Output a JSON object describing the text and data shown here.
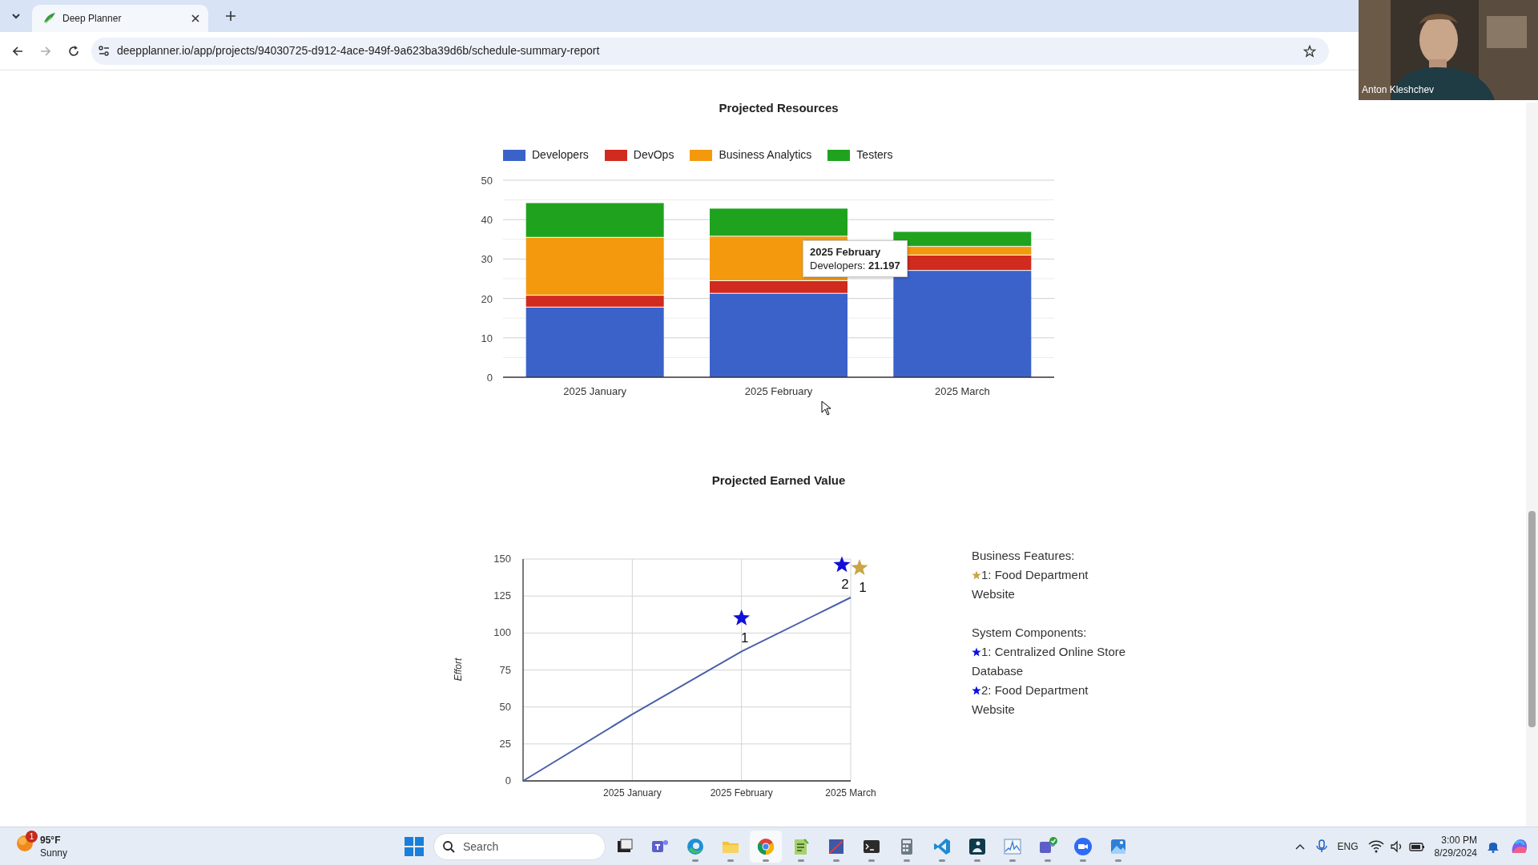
{
  "browser": {
    "tab_title": "Deep Planner",
    "url": "deepplanner.io/app/projects/94030725-d912-4ace-949f-9a623ba39d6b/schedule-summary-report",
    "forward_disabled": true
  },
  "resources_chart": {
    "chart_data": {
      "type": "bar",
      "title": "Projected Resources",
      "categories": [
        "2025 January",
        "2025 February",
        "2025 March"
      ],
      "stacked": true,
      "grid": true,
      "legend": true,
      "ylim": [
        0,
        50
      ],
      "yticks": [
        0,
        10,
        20,
        30,
        40,
        50
      ],
      "series": [
        {
          "name": "Developers",
          "color": "#3b62c9",
          "values": [
            17.7,
            21.197,
            27.0
          ]
        },
        {
          "name": "DevOps",
          "color": "#d02b1e",
          "values": [
            3.0,
            3.2,
            3.9
          ]
        },
        {
          "name": "Business Analytics",
          "color": "#f4990e",
          "values": [
            14.7,
            11.3,
            2.2
          ]
        },
        {
          "name": "Testers",
          "color": "#1fa31f",
          "values": [
            8.8,
            7.1,
            3.8
          ]
        }
      ]
    },
    "tooltip": {
      "title": "2025 February",
      "text": "Developers: **21.197**"
    }
  },
  "earned_value_chart": {
    "chart_data": {
      "type": "line",
      "title": "Projected Earned Value",
      "grid": true,
      "ylabel": "Effort",
      "categories": [
        null,
        "2025 January",
        "2025 February",
        "2025 March"
      ],
      "ylim": [
        0,
        150
      ],
      "yticks": [
        0,
        25,
        50,
        75,
        100,
        125,
        150
      ],
      "series": [
        {
          "color": "#4a5fa8",
          "values": [
            0,
            45,
            87.5,
            124
          ]
        },
        {
          "type": "scatter",
          "color": "#1010d8",
          "marker": "star",
          "values": [
            null,
            null,
            110,
            146
          ]
        },
        {
          "type": "scatter",
          "color": "#c9a546",
          "marker": "star",
          "values": [
            null,
            null,
            null,
            144
          ]
        }
      ],
      "annotations": [
        {
          "x": "2025 February",
          "y": 110,
          "text": "1"
        },
        {
          "x": "2025 March",
          "y": 146,
          "text": "2"
        },
        {
          "x": "2025 March",
          "y": 144,
          "text": "1"
        }
      ]
    }
  },
  "milestones": [
    {
      "heading": "Business Features:",
      "items": [
        {
          "color": "#c9a546",
          "text": "1: Food Department Website"
        }
      ]
    },
    {
      "heading": "System Components:",
      "items": [
        {
          "color": "#1010d8",
          "text": "1: Centralized Online Store Database"
        },
        {
          "color": "#1010d8",
          "text": "2: Food Department Website"
        }
      ]
    }
  ],
  "webcam": {
    "name": "Anton Kleshchev"
  },
  "taskbar": {
    "weather": {
      "badge": "1",
      "temperature": "95°F",
      "condition": "Sunny"
    },
    "search_placeholder": "Search",
    "apps": [
      {
        "kind": "window",
        "running": false,
        "selected": false
      },
      {
        "kind": "teams",
        "running": false,
        "selected": false
      },
      {
        "kind": "edge",
        "running": true,
        "selected": false
      },
      {
        "kind": "folder",
        "running": true,
        "selected": false
      },
      {
        "kind": "chrome",
        "running": true,
        "selected": true
      },
      {
        "kind": "notepad",
        "running": true,
        "selected": false
      },
      {
        "kind": "sketch",
        "running": true,
        "selected": false
      },
      {
        "kind": "terminal",
        "running": true,
        "selected": false
      },
      {
        "kind": "calculator",
        "running": true,
        "selected": false
      },
      {
        "kind": "vscode",
        "running": true,
        "selected": false
      },
      {
        "kind": "reader",
        "running": true,
        "selected": false
      },
      {
        "kind": "monitor",
        "running": true,
        "selected": false
      },
      {
        "kind": "teams-check",
        "running": true,
        "selected": false
      },
      {
        "kind": "zoom",
        "running": true,
        "selected": false
      },
      {
        "kind": "photos",
        "running": true,
        "selected": false
      }
    ],
    "language": "ENG",
    "time": "3:00 PM",
    "date": "8/29/2024"
  }
}
